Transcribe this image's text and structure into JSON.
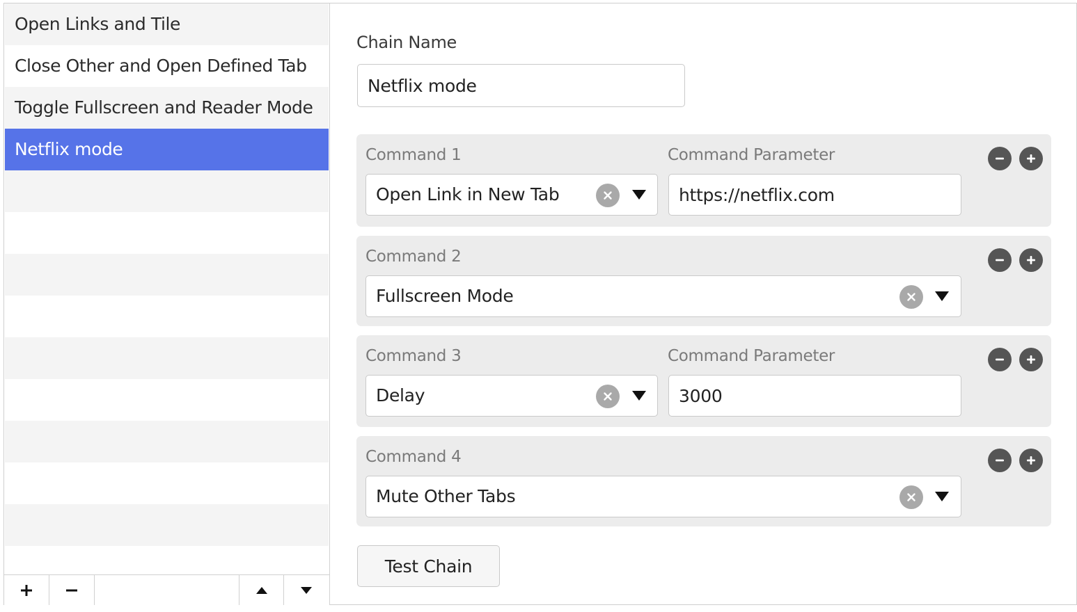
{
  "sidebar": {
    "items": [
      {
        "label": "Open Links and Tile"
      },
      {
        "label": "Close Other and Open Defined Tab"
      },
      {
        "label": "Toggle Fullscreen and Reader Mode"
      },
      {
        "label": "Netflix mode",
        "selected": true
      }
    ],
    "toolbar": {
      "add_icon": "plus-icon",
      "remove_icon": "minus-icon",
      "move_up_icon": "triangle-up-icon",
      "move_down_icon": "triangle-down-icon"
    },
    "selected_color": "#5673e8"
  },
  "main": {
    "chain_name_label": "Chain Name",
    "chain_name_value": "Netflix mode",
    "commands": [
      {
        "label": "Command 1",
        "value": "Open Link in New Tab",
        "param_label": "Command Parameter",
        "param_value": "https://netflix.com"
      },
      {
        "label": "Command 2",
        "value": "Fullscreen Mode"
      },
      {
        "label": "Command 3",
        "value": "Delay",
        "param_label": "Command Parameter",
        "param_value": "3000"
      },
      {
        "label": "Command 4",
        "value": "Mute Other Tabs"
      }
    ],
    "test_button_label": "Test Chain"
  }
}
